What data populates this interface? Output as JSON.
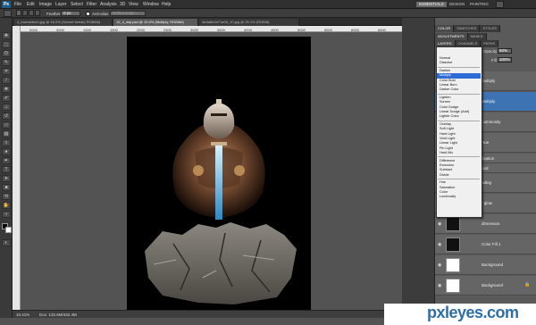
{
  "menu": {
    "logo": "Ps",
    "items": [
      "File",
      "Edit",
      "Image",
      "Layer",
      "Select",
      "Filter",
      "Analysis",
      "3D",
      "View",
      "Window",
      "Help"
    ]
  },
  "workspaces": {
    "items": [
      "ESSENTIALS",
      "DESIGN",
      "PAINTING"
    ],
    "active": "ESSENTIALS"
  },
  "options": {
    "feather_label": "Feather:",
    "feather_value": "0 px",
    "antialias_label": "Anti-alias",
    "refine_label": "Refine Edge..."
  },
  "doc_tabs": [
    {
      "label": "4_lowmedium.jpg @ 16.2% (Sunset tweak) RGB/8#)",
      "active": false
    },
    {
      "label": "12_4_wip.psd @ 10.4% (Multiply, RGB/8#)",
      "active": true
    },
    {
      "label": "4e4a6b1b71a09_10.jpg @ 25.1% (RGB/8)",
      "active": false
    }
  ],
  "ruler_ticks": [
    "0000",
    "3000",
    "1000",
    "1500",
    "2000",
    "2500",
    "3000",
    "3500",
    "4000",
    "4500",
    "5000",
    "5500",
    "6000",
    "6500"
  ],
  "status": {
    "zoom": "10.41%",
    "doc": "Doc: 132.6M/432.4M"
  },
  "panels": {
    "top_tabs": [
      "COLOR",
      "SWATCHES",
      "STYLES"
    ],
    "adj_tabs": [
      "ADJUSTMENTS",
      "MASKS"
    ],
    "layer_tabs": [
      "LAYERS",
      "CHANNELS",
      "PATHS"
    ],
    "opacity_label": "Opacity:",
    "opacity_value": "60%",
    "fill_label": "Fill:",
    "fill_value": "100%"
  },
  "blend_mode": {
    "selected": "Multiply",
    "groups": [
      [
        "Normal",
        "Dissolve"
      ],
      [
        "Darken",
        "Multiply",
        "Color Burn",
        "Linear Burn",
        "Darker Color"
      ],
      [
        "Lighten",
        "Screen",
        "Color Dodge",
        "Linear Dodge (Add)",
        "Lighter Color"
      ],
      [
        "Overlay",
        "Soft Light",
        "Hard Light",
        "Vivid Light",
        "Linear Light",
        "Pin Light",
        "Hard Mix"
      ],
      [
        "Difference",
        "Exclusion",
        "Subtract",
        "Divide"
      ],
      [
        "Hue",
        "Saturation",
        "Color",
        "Luminosity"
      ]
    ]
  },
  "layers": [
    {
      "name": "multiply",
      "selected": false
    },
    {
      "name": "Multiply",
      "selected": true
    },
    {
      "name": "Luminosity",
      "selected": false
    },
    {
      "name": "Hue",
      "selected": false
    },
    {
      "name": "fixation",
      "selected": false
    },
    {
      "name": "ood",
      "selected": false
    },
    {
      "name": "ading",
      "selected": false
    },
    {
      "name": "r glow",
      "selected": false
    },
    {
      "name": "dimension",
      "selected": false
    },
    {
      "name": "Color Fill 1",
      "selected": false
    },
    {
      "name": "Background",
      "selected": false
    },
    {
      "name": "Background",
      "selected": false
    }
  ],
  "watermark": "pxleyes.com"
}
